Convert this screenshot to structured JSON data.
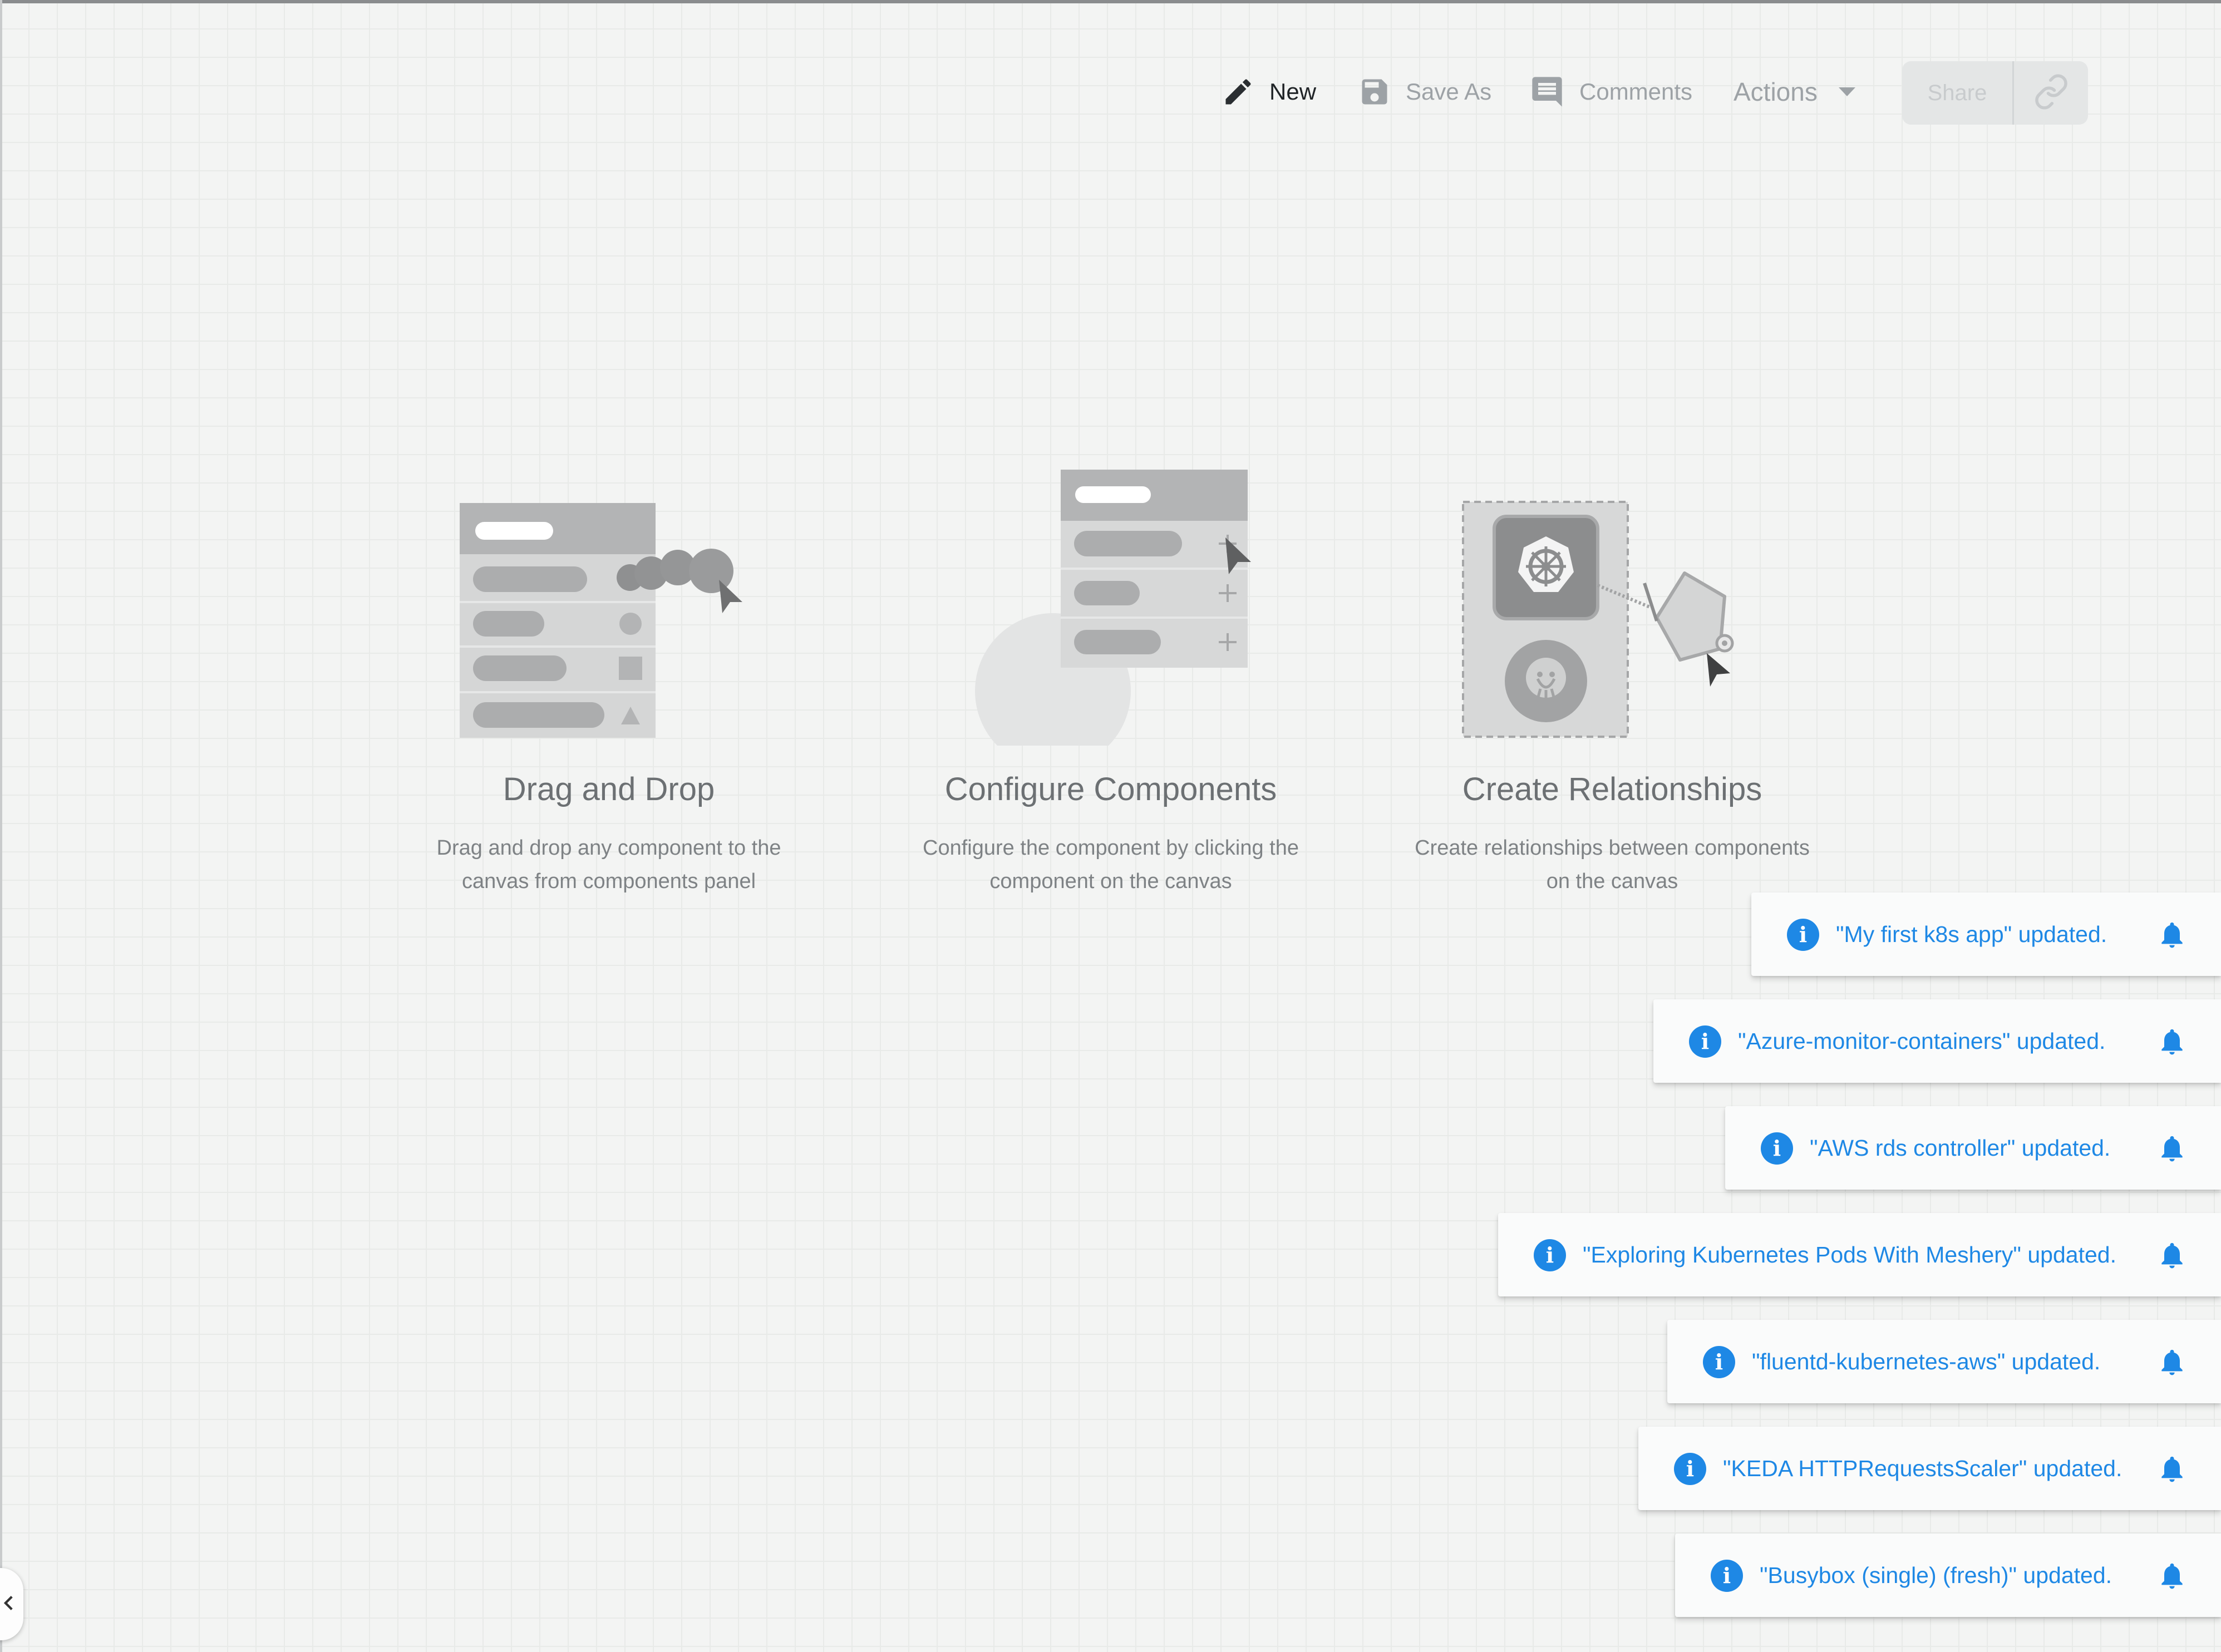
{
  "toolbar": {
    "new_label": "New",
    "save_as_label": "Save As",
    "comments_label": "Comments",
    "actions_label": "Actions",
    "share_label": "Share"
  },
  "onboarding": [
    {
      "title": "Drag and Drop",
      "line1": "Drag and drop any component to the",
      "line2": "canvas from components panel"
    },
    {
      "title": "Configure Components",
      "line1": "Configure the component by clicking the",
      "line2": "component on the canvas"
    },
    {
      "title": "Create Relationships",
      "line1": "Create relationships between components",
      "line2": "on the canvas"
    }
  ],
  "notifications": [
    {
      "message": "\"My first k8s app\" updated."
    },
    {
      "message": "\"Azure-monitor-containers\" updated."
    },
    {
      "message": "\"AWS rds controller\" updated."
    },
    {
      "message": "\"Exploring Kubernetes Pods With Meshery\" updated."
    },
    {
      "message": "\"fluentd-kubernetes-aws\" updated."
    },
    {
      "message": "\"KEDA HTTPRequestsScaler\" updated."
    },
    {
      "message": "\"Busybox (single) (fresh)\" updated."
    }
  ],
  "colors": {
    "info_blue": "#1e88e5",
    "muted_text": "#9da2a6",
    "canvas_bg": "#f3f4f3"
  },
  "icons": [
    "pencil-icon",
    "floppy-disk-icon",
    "comment-icon",
    "caret-down-icon",
    "link-icon",
    "info-icon",
    "bell-icon",
    "chevron-left-icon"
  ]
}
